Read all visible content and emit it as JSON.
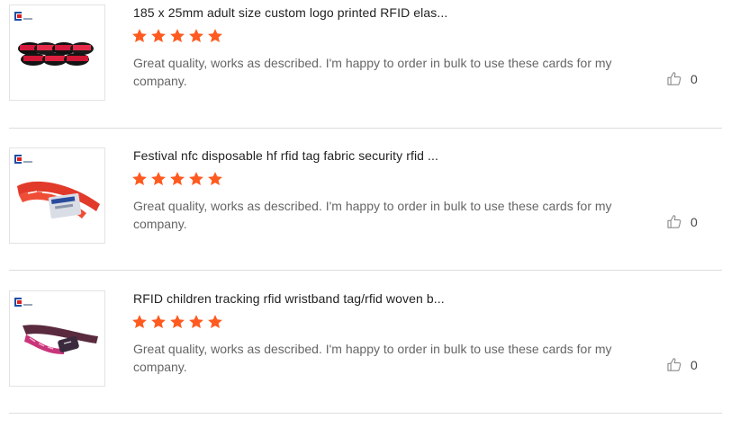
{
  "reviews": [
    {
      "product_title": "185 x 25mm adult size custom logo printed RFID elas...",
      "rating": 5,
      "rating_max": 5,
      "comment": "Great quality, works as described. I'm happy to order in bulk to use these cards for my company.",
      "helpful_count": "0",
      "thumbnail": "black and red silicone wristbands"
    },
    {
      "product_title": "Festival nfc disposable hf rfid tag fabric security rfid ...",
      "rating": 5,
      "rating_max": 5,
      "comment": "Great quality, works as described. I'm happy to order in bulk to use these cards for my company.",
      "helpful_count": "0",
      "thumbnail": "red fabric festival wristband with card tag"
    },
    {
      "product_title": "RFID children tracking rfid wristband tag/rfid woven b...",
      "rating": 5,
      "rating_max": 5,
      "comment": "Great quality, works as described. I'm happy to order in bulk to use these cards for my company.",
      "helpful_count": "0",
      "thumbnail": "pink woven wristband with tag"
    }
  ],
  "colors": {
    "star": "#ff5a1f",
    "divider": "#dddddd",
    "brand_logo_blue": "#1f4fa3",
    "brand_logo_red": "#e02020"
  },
  "icons": {
    "rating": "star-icon",
    "helpful": "thumbs-up-icon",
    "thumbnail_badge": "brand-logo-icon"
  }
}
